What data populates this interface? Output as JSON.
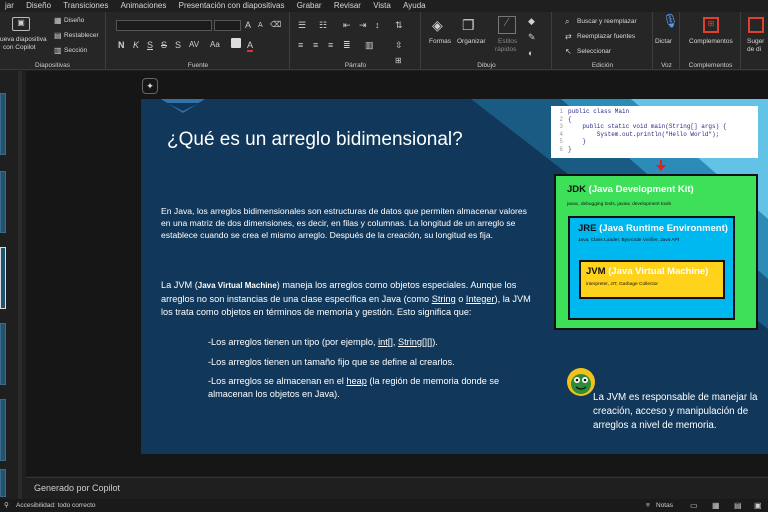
{
  "menu": [
    "jar",
    "Diseño",
    "Transiciones",
    "Animaciones",
    "Presentación con diapositivas",
    "Grabar",
    "Revisar",
    "Vista",
    "Ayuda"
  ],
  "ribbon": {
    "diapositivas": {
      "new_slide_1": "ueva diapositiva",
      "new_slide_2": "con Copilot",
      "layout": "Diseño",
      "reset": "Restablecer",
      "section": "Sección",
      "label": "Diapositivas"
    },
    "fuente": {
      "label": "Fuente",
      "increase": "A",
      "decrease": "A",
      "bold": "N",
      "italic": "K",
      "underline": "S",
      "strike": "S",
      "shadow": "S",
      "spacing": "AV",
      "case": "Aa",
      "color": "A"
    },
    "parrafo": {
      "label": "Párrafo"
    },
    "dibujo": {
      "label": "Dibujo",
      "shapes": "Formas",
      "arrange": "Organizar",
      "styles_1": "Estilos",
      "styles_2": "rápidos"
    },
    "edicion": {
      "label": "Edición",
      "find": "Buscar y reemplazar",
      "replace": "Reemplazar fuentes",
      "select": "Seleccionar"
    },
    "voz": {
      "label": "Voz",
      "dictate": "Dictar"
    },
    "complementos": {
      "label": "Complementos",
      "addins": "Complementos"
    },
    "designer": {
      "label_1": "Suger",
      "label_2": "de di"
    }
  },
  "slide": {
    "title": "¿Qué es un arreglo bidimensional?",
    "para1": "En Java, los arreglos bidimensionales son estructuras de datos que permiten almacenar valores en una matriz de dos dimensiones, es decir, en filas y columnas. La longitud de un arreglo se establece cuando se crea el mismo arreglo. Después de la creación, su longitud es fija.",
    "para2_a": "La JVM (",
    "para2_b": "Java Virtual Machine",
    "para2_c": ") maneja los arreglos como objetos especiales. Aunque los arreglos no son instancias de una clase específica en Java (como ",
    "para2_d": "String",
    "para2_e": " o ",
    "para2_f": "Integer",
    "para2_g": "), la JVM los trata como objetos en términos de memoria y gestión. Esto significa que:",
    "bullet1_a": "-Los arreglos tienen un tipo (por ejemplo, ",
    "bullet1_b": "int[]",
    "bullet1_c": ", ",
    "bullet1_d": "String[][]",
    "bullet1_e": ").",
    "bullet2": "-Los arreglos tienen un tamaño fijo que se define al crearlos.",
    "bullet3_a": "-Los arreglos se almacenan en el ",
    "bullet3_b": "heap",
    "bullet3_c": " (la región de memoria donde se almacenan los objetos en Java).",
    "code": {
      "lines": [
        "1",
        "2",
        "3",
        "4",
        "5",
        "6"
      ],
      "src": "public class Main\n{\n    public static void main(String[] args) {\n        System.out.println(\"Hello World\");\n    }\n}"
    },
    "jdk": {
      "short": "JDK",
      "long": "(Java Development Kit)",
      "sub": "javac, debugging tools, javaw, development tools"
    },
    "jre": {
      "short": "JRE",
      "long": "(Java Runtime Environment)",
      "sub": "Java, Class Loader, Bytecode Verifier, Java API"
    },
    "jvm": {
      "short": "JVM",
      "long": "(Java Virtual Machine)",
      "sub": "interpreter, JIT, Garbage Collector"
    },
    "jvm_note": "La JVM es responsable de manejar la creación, acceso y manipulación de arreglos a nivel de memoria."
  },
  "notes": "Generado por Copilot",
  "status": {
    "accessibility": "Accesibilidad: todo correcto",
    "notes": "Notas"
  },
  "colors": {
    "slide_bg": "#11385b",
    "jdk": "#3ee05a",
    "jre": "#00b8f0",
    "jvm": "#ffd21c",
    "arrow": "#e02020"
  }
}
